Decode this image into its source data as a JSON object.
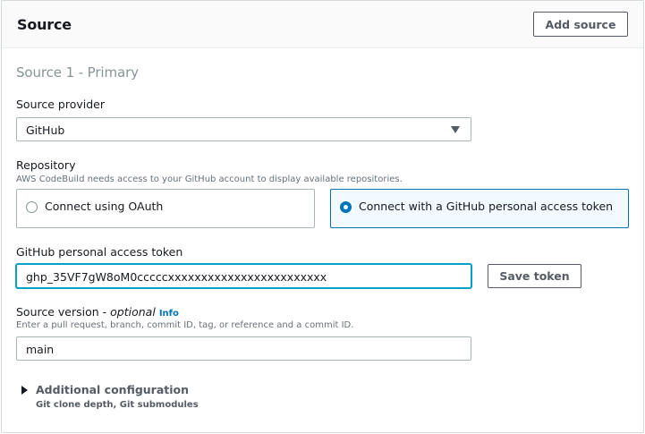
{
  "panel": {
    "title": "Source",
    "add_source_label": "Add source"
  },
  "source": {
    "section_title": "Source 1 - Primary",
    "provider": {
      "label": "Source provider",
      "selected": "GitHub"
    },
    "repository": {
      "label": "Repository",
      "hint": "AWS CodeBuild needs access to your GitHub account to display available repositories.",
      "options": [
        {
          "label": "Connect using OAuth",
          "selected": false
        },
        {
          "label": "Connect with a GitHub personal access token",
          "selected": true
        }
      ]
    },
    "token": {
      "label": "GitHub personal access token",
      "value": "ghp_35VF7gW8oM0cccccxxxxxxxxxxxxxxxxxxxxxxxx",
      "save_label": "Save token"
    },
    "version": {
      "label": "Source version - ",
      "optional": "optional",
      "info": "Info",
      "hint": "Enter a pull request, branch, commit ID, tag, or reference and a commit ID.",
      "value": "main"
    },
    "additional": {
      "label": "Additional configuration",
      "sub": "Git clone depth, Git submodules"
    }
  },
  "colors": {
    "accent": "#0073bb",
    "focus": "#00a1c9",
    "border": "#aab7b8"
  }
}
